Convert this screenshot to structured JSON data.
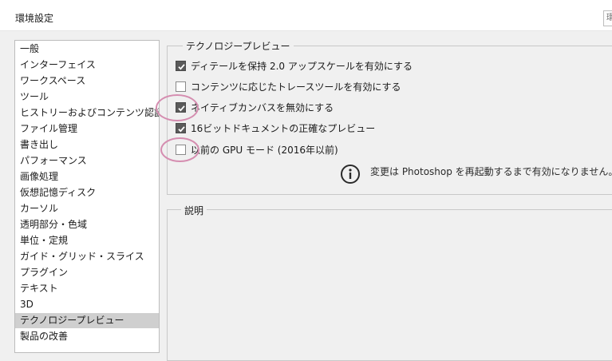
{
  "window": {
    "title": "環境設定",
    "title_button_glyph": "環"
  },
  "sidebar": {
    "items": [
      {
        "label": "一般"
      },
      {
        "label": "インターフェイス"
      },
      {
        "label": "ワークスペース"
      },
      {
        "label": "ツール"
      },
      {
        "label": "ヒストリーおよびコンテンツ認証情報"
      },
      {
        "label": "ファイル管理"
      },
      {
        "label": "書き出し"
      },
      {
        "label": "パフォーマンス"
      },
      {
        "label": "画像処理"
      },
      {
        "label": "仮想記憶ディスク"
      },
      {
        "label": "カーソル"
      },
      {
        "label": "透明部分・色域"
      },
      {
        "label": "単位・定規"
      },
      {
        "label": "ガイド・グリッド・スライス"
      },
      {
        "label": "プラグイン"
      },
      {
        "label": "テキスト"
      },
      {
        "label": "3D"
      },
      {
        "label": "テクノロジープレビュー",
        "selected": true
      },
      {
        "label": "製品の改善"
      }
    ]
  },
  "tech_preview": {
    "title": "テクノロジープレビュー",
    "options": [
      {
        "label": "ディテールを保持 2.0 アップスケールを有効にする",
        "checked": true
      },
      {
        "label": "コンテンツに応じたトレースツールを有効にする",
        "checked": false
      },
      {
        "label": "ネイティブカンバスを無効にする",
        "checked": true
      },
      {
        "label": "16ビットドキュメントの正確なプレビュー",
        "checked": true
      },
      {
        "label": "以前の GPU モード (2016年以前)",
        "checked": false
      }
    ],
    "restart_notice": "変更は Photoshop を再起動するまで有効になりません。"
  },
  "description": {
    "title": "説明"
  },
  "colors": {
    "annotation_circle": "#d58db0",
    "checkbox_checked": "#5a5a5a",
    "selected_row": "#cfcfcf"
  },
  "icons": {
    "info": "info-circle-icon",
    "check": "checkmark-icon"
  }
}
